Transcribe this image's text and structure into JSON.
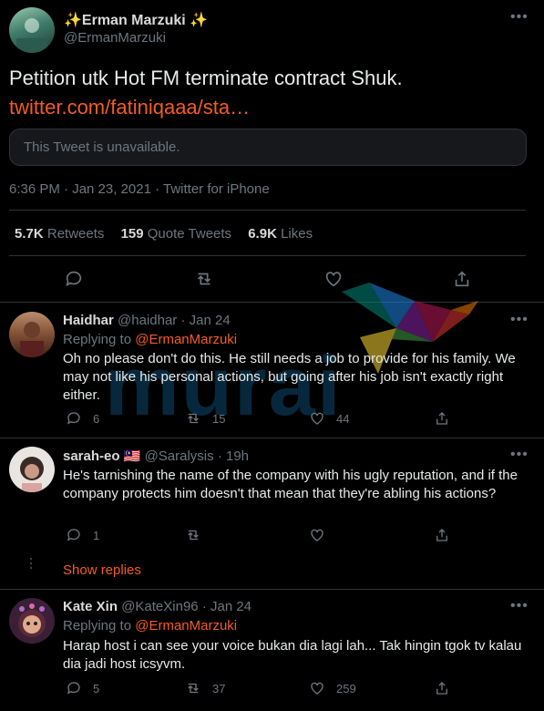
{
  "main_tweet": {
    "display_name": "✨Erman Marzuki ✨",
    "handle": "@ErmanMarzuki",
    "text": "Petition utk Hot FM terminate contract Shuk.",
    "link": "twitter.com/fatiniqaaa/sta…",
    "unavailable": "This Tweet is unavailable.",
    "timestamp": "6:36 PM · Jan 23, 2021 · Twitter for iPhone",
    "stats": {
      "retweets_count": "5.7K",
      "retweets_label": "Retweets",
      "quotes_count": "159",
      "quotes_label": "Quote Tweets",
      "likes_count": "6.9K",
      "likes_label": "Likes"
    }
  },
  "replies": [
    {
      "name": "Haidhar",
      "handle": "@haidhar",
      "time": "· Jan 24",
      "replying_prefix": "Replying to",
      "replying_to": "@ErmanMarzuki",
      "text": "Oh no please don't do this. He still needs a job to provide for his family. We may not like his personal actions, but going after his job isn't exactly right either.",
      "reply_count": "6",
      "retweet_count": "15",
      "like_count": "44"
    },
    {
      "name": "sarah-eo",
      "flag": "🇲🇾",
      "handle": "@Saralysis",
      "time": "· 19h",
      "text": "He's tarnishing the name of the company with his ugly reputation, and if the company protects him doesn't that mean that they're abling his actions?",
      "reply_count": "1",
      "retweet_count": "",
      "like_count": ""
    },
    {
      "name": "Kate Xin",
      "handle": "@KateXin96",
      "time": "· Jan 24",
      "replying_prefix": "Replying to",
      "replying_to": "@ErmanMarzuki",
      "text": "Harap host i can see your voice bukan dia lagi lah... Tak hingin tgok tv kalau dia jadi host icsyvm.",
      "reply_count": "5",
      "retweet_count": "37",
      "like_count": "259"
    }
  ],
  "show_replies": "Show replies",
  "watermark_text": "murai",
  "colors": {
    "accent": "#f45d22",
    "muted": "#6e767d",
    "background": "#000000"
  }
}
